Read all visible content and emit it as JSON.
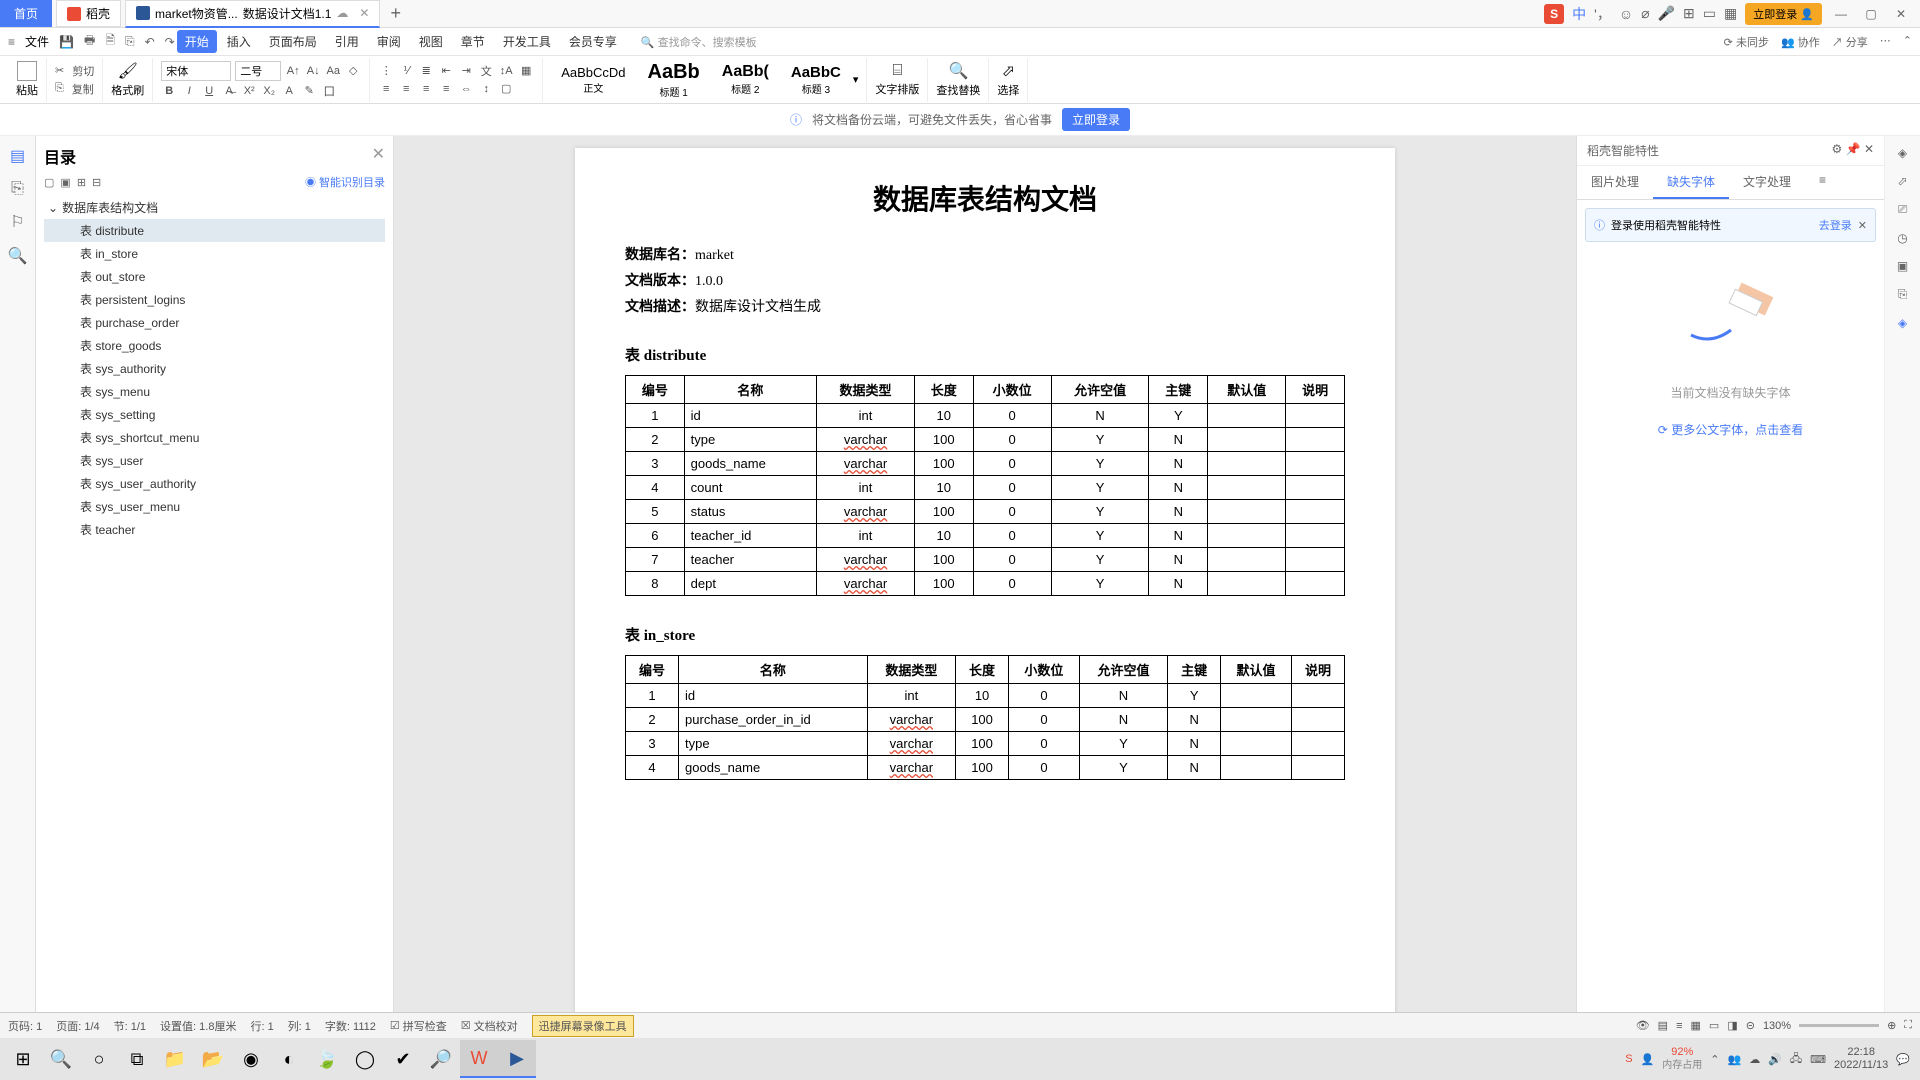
{
  "titlebar": {
    "home": "首页",
    "tab1": "稻壳",
    "tab2_prefix": "market物资管...",
    "tab2_suffix": "数据设计文档1.1",
    "login": "立即登录"
  },
  "menubar": {
    "file": "文件",
    "items": [
      "开始",
      "插入",
      "页面布局",
      "引用",
      "审阅",
      "视图",
      "章节",
      "开发工具",
      "会员专享"
    ],
    "search_placeholder": "查找命令、搜索模板",
    "right": {
      "nosync": "未同步",
      "coop": "协作",
      "share": "分享"
    }
  },
  "ribbon": {
    "paste": "粘贴",
    "cut": "剪切",
    "copy": "复制",
    "brush": "格式刷",
    "font_name": "宋体",
    "font_size": "二号",
    "styles": {
      "body_p": "AaBbCcDd",
      "body": "正文",
      "h1_p": "AaBb",
      "h1": "标题 1",
      "h2_p": "AaBb(",
      "h2": "标题 2",
      "h3_p": "AaBbC",
      "h3": "标题 3"
    },
    "layout": "文字排版",
    "find": "查找替换",
    "select": "选择"
  },
  "banner": {
    "text": "将文档备份云端，可避免文件丢失，省心省事",
    "btn": "立即登录"
  },
  "outline": {
    "title": "目录",
    "smart": "智能识别目录",
    "root": "数据库表结构文档",
    "items": [
      "表 distribute",
      "表 in_store",
      "表 out_store",
      "表 persistent_logins",
      "表 purchase_order",
      "表 store_goods",
      "表 sys_authority",
      "表 sys_menu",
      "表 sys_setting",
      "表 sys_shortcut_menu",
      "表 sys_user",
      "表 sys_user_authority",
      "表 sys_user_menu",
      "表 teacher"
    ]
  },
  "document": {
    "title": "数据库表结构文档",
    "meta": [
      {
        "label": "数据库名：",
        "value": "market"
      },
      {
        "label": "文档版本：",
        "value": "1.0.0"
      },
      {
        "label": "文档描述：",
        "value": "数据库设计文档生成"
      }
    ],
    "tables": [
      {
        "title": "表 distribute",
        "headers": [
          "编号",
          "名称",
          "数据类型",
          "长度",
          "小数位",
          "允许空值",
          "主键",
          "默认值",
          "说明"
        ],
        "rows": [
          [
            "1",
            "id",
            "int",
            "10",
            "0",
            "N",
            "Y",
            "",
            ""
          ],
          [
            "2",
            "type",
            "varchar",
            "100",
            "0",
            "Y",
            "N",
            "",
            ""
          ],
          [
            "3",
            "goods_name",
            "varchar",
            "100",
            "0",
            "Y",
            "N",
            "",
            ""
          ],
          [
            "4",
            "count",
            "int",
            "10",
            "0",
            "Y",
            "N",
            "",
            ""
          ],
          [
            "5",
            "status",
            "varchar",
            "100",
            "0",
            "Y",
            "N",
            "",
            ""
          ],
          [
            "6",
            "teacher_id",
            "int",
            "10",
            "0",
            "Y",
            "N",
            "",
            ""
          ],
          [
            "7",
            "teacher",
            "varchar",
            "100",
            "0",
            "Y",
            "N",
            "",
            ""
          ],
          [
            "8",
            "dept",
            "varchar",
            "100",
            "0",
            "Y",
            "N",
            "",
            ""
          ]
        ]
      },
      {
        "title": "表 in_store",
        "headers": [
          "编号",
          "名称",
          "数据类型",
          "长度",
          "小数位",
          "允许空值",
          "主键",
          "默认值",
          "说明"
        ],
        "rows": [
          [
            "1",
            "id",
            "int",
            "10",
            "0",
            "N",
            "Y",
            "",
            ""
          ],
          [
            "2",
            "purchase_order_in_id",
            "varchar",
            "100",
            "0",
            "N",
            "N",
            "",
            ""
          ],
          [
            "3",
            "type",
            "varchar",
            "100",
            "0",
            "Y",
            "N",
            "",
            ""
          ],
          [
            "4",
            "goods_name",
            "varchar",
            "100",
            "0",
            "Y",
            "N",
            "",
            ""
          ]
        ]
      }
    ]
  },
  "rightpanel": {
    "title": "稻壳智能特性",
    "tabs": [
      "图片处理",
      "缺失字体",
      "文字处理"
    ],
    "tip": "登录使用稻壳智能特性",
    "tip_link": "去登录",
    "msg": "当前文档没有缺失字体",
    "link": "更多公文字体，点击查看"
  },
  "statusbar": {
    "page_label": "页码: 1",
    "page_of": "页面: 1/4",
    "section": "节: 1/1",
    "setval": "设置值: 1.8厘米",
    "row": "行: 1",
    "col": "列: 1",
    "words": "字数: 1112",
    "spell": "拼写检查",
    "proof": "文档校对",
    "tooltip": "迅捷屏幕录像工具",
    "zoom": "130%"
  },
  "taskbar": {
    "mem_pct": "92%",
    "mem_label": "内存占用",
    "time": "22:18",
    "date": "2022/11/13"
  }
}
